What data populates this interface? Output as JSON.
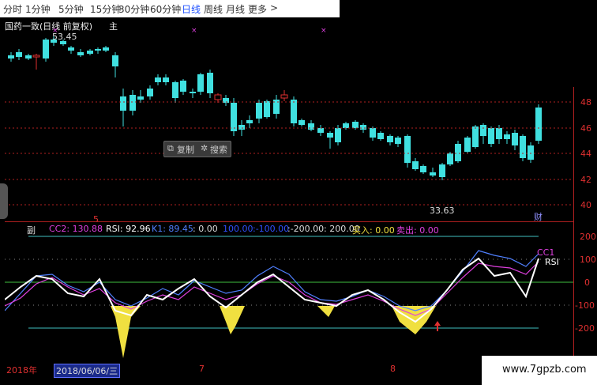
{
  "toolbar": {
    "items": [
      "分时",
      "1分钟",
      "5分钟",
      "15分钟",
      "30分钟",
      "60分钟",
      "日线",
      "周线",
      "月线",
      "更多"
    ],
    "active": "日线",
    "more_arrow": ">"
  },
  "main_chart": {
    "title": "国药一致(日线 前复权)",
    "main_label": "主",
    "high_label": "53.45",
    "low_label": "33.63",
    "cai_label": "财",
    "sub_marker": "5",
    "y_ticks": [
      "48",
      "46",
      "44",
      "42",
      "40"
    ]
  },
  "popup": {
    "copy_label": "复制",
    "search_label": "搜索"
  },
  "sub_chart": {
    "label": "副",
    "cc2": "CC2: 130.88",
    "rsi": "RSI: 92.96",
    "k1": "K1: 89.45",
    "v1": ": 0.00",
    "v2": "100.00",
    "v3": ":-100.00",
    "v4": ":-200.00",
    "v5": ": 200.00",
    "buy": "买入: 0.00",
    "sell": "卖出: 0.00",
    "cc1_tag": "CC1",
    "rsi_tag": "RSI",
    "y_ticks": [
      "200",
      "100",
      "0",
      "-100",
      "-200"
    ]
  },
  "bottom": {
    "year": "2018年",
    "date": "2018/06/06/三",
    "month7": "7",
    "month8": "8"
  },
  "watermark": "www.7gpzb.com",
  "colors": {
    "up": "#e03030",
    "down": "#40e0e0",
    "yellow": "#f0e040",
    "magenta": "#e040e0",
    "blue": "#5060ff",
    "active": "#1e50ff"
  }
}
